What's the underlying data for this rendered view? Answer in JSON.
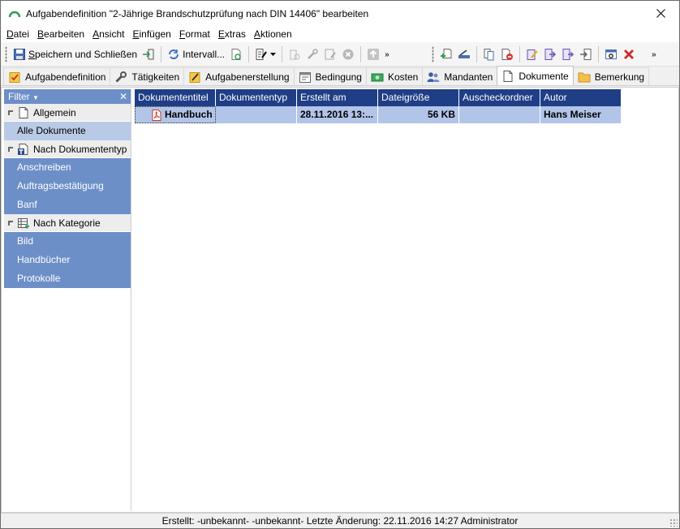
{
  "window": {
    "title": "Aufgabendefinition \"2-Jährige Brandschutzprüfung nach DIN 14406\" bearbeiten"
  },
  "menu": [
    {
      "acc": "D",
      "rest": "atei"
    },
    {
      "acc": "B",
      "rest": "earbeiten"
    },
    {
      "acc": "A",
      "rest": "nsicht"
    },
    {
      "acc": "E",
      "rest": "infügen"
    },
    {
      "acc": "F",
      "rest": "ormat"
    },
    {
      "acc": "E",
      "rest": "xtras"
    },
    {
      "acc": "A",
      "rest": "ktionen"
    }
  ],
  "toolbar": {
    "save_acc": "S",
    "save_rest": "peichern und Schließen",
    "interval_label": "Intervall...",
    "more_glyph": "»"
  },
  "tabs": [
    {
      "label": "Aufgabendefinition",
      "icon": "task-checklist-icon"
    },
    {
      "label": "Tätigkeiten",
      "icon": "wrench-icon"
    },
    {
      "label": "Aufgabenerstellung",
      "icon": "task-create-icon"
    },
    {
      "label": "Bedingung",
      "icon": "calendar-condition-icon"
    },
    {
      "label": "Kosten",
      "icon": "money-icon"
    },
    {
      "label": "Mandanten",
      "icon": "users-icon"
    },
    {
      "label": "Dokumente",
      "icon": "document-icon",
      "active": true
    },
    {
      "label": "Bemerkung",
      "icon": "folder-note-icon"
    }
  ],
  "filter": {
    "header": "Filter",
    "close_glyph": "✕",
    "groups": [
      {
        "label": "Allgemein",
        "icon": "document-icon",
        "items": [
          {
            "label": "Alle Dokumente",
            "selected": true
          }
        ]
      },
      {
        "label": "Nach Dokumententyp",
        "icon": "doctype-icon",
        "items": [
          {
            "label": "Anschreiben"
          },
          {
            "label": "Auftragsbestätigung"
          },
          {
            "label": "Banf"
          }
        ]
      },
      {
        "label": "Nach Kategorie",
        "icon": "category-icon",
        "items": [
          {
            "label": "Bild"
          },
          {
            "label": "Handbücher"
          },
          {
            "label": "Protokolle"
          }
        ]
      }
    ]
  },
  "grid": {
    "columns": [
      "Dokumententitel",
      "Dokumententyp",
      "Erstellt am",
      "Dateigröße",
      "Auscheckordner",
      "Autor"
    ],
    "rows": [
      {
        "title": "Handbuch",
        "type": "",
        "created": "28.11.2016 13:...",
        "size": "56 KB",
        "checkout": "",
        "author": "Hans Meiser"
      }
    ]
  },
  "status": {
    "text": "Erstellt: -unbekannt- -unbekannt-  Letzte Änderung: 22.11.2016 14:27 Administrator"
  },
  "colors": {
    "accent": "#1f3e86",
    "filter_blue": "#6d8fc8",
    "selection": "#b2c4e8"
  }
}
